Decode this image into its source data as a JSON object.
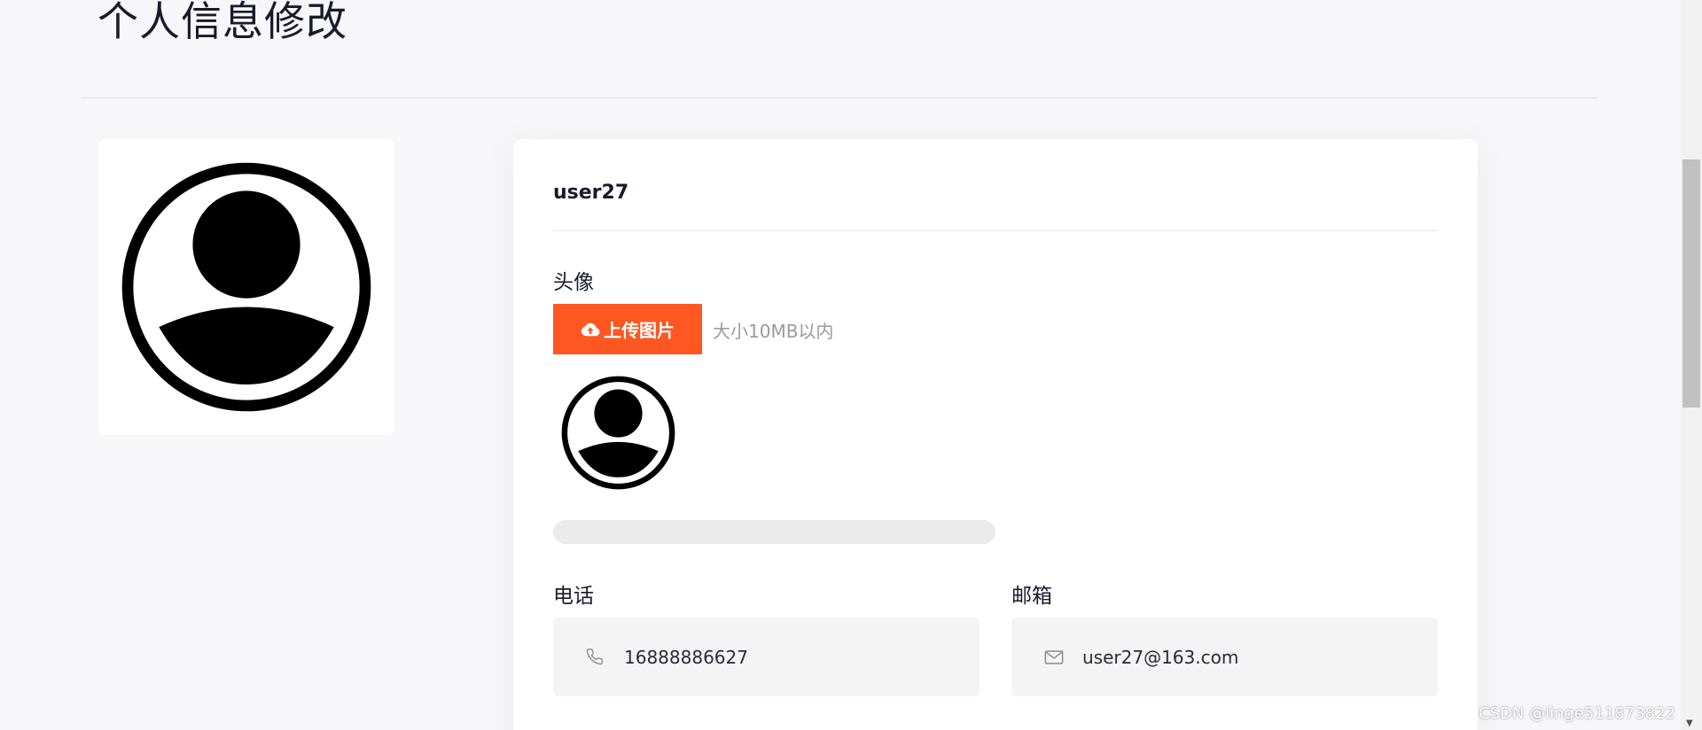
{
  "page": {
    "title": "个人信息修改"
  },
  "profile": {
    "username": "user27",
    "avatar_icon": "user-circle-icon"
  },
  "avatar_section": {
    "label": "头像",
    "upload_button_label": "上传图片",
    "upload_icon": "cloud-upload-icon",
    "hint": "大小10MB以内",
    "progress_fraction": 0
  },
  "phone": {
    "label": "电话",
    "icon": "phone-icon",
    "value": "16888886627"
  },
  "email": {
    "label": "邮箱",
    "icon": "mail-icon",
    "value": "user27@163.com"
  },
  "watermark": "CSDN @linge511873822",
  "colors": {
    "accent": "#fe5722",
    "background": "#f7f7f9",
    "card": "#ffffff",
    "input_bg": "#f4f4f5"
  }
}
